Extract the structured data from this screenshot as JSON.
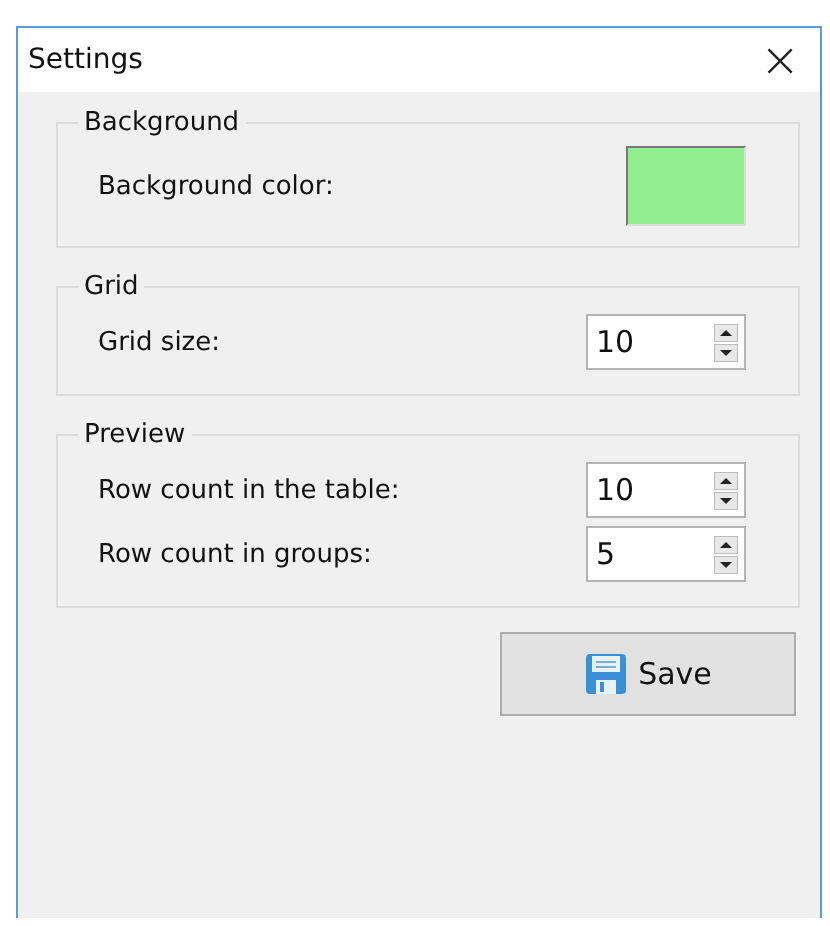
{
  "window": {
    "title": "Settings",
    "close": "×"
  },
  "groups": [
    {
      "title": "Background",
      "fields": [
        {
          "kind": "color",
          "label": "Background color:",
          "color": "#90ee90"
        }
      ]
    },
    {
      "title": "Grid",
      "fields": [
        {
          "kind": "spinner",
          "label": "Grid size:",
          "value": "10"
        }
      ]
    },
    {
      "title": "Preview",
      "fields": [
        {
          "kind": "spinner",
          "label": "Row count in the table:",
          "value": "10"
        },
        {
          "kind": "spinner",
          "label": "Row count in groups:",
          "value": "5"
        }
      ]
    }
  ],
  "buttons": [
    {
      "label": "Save"
    }
  ]
}
